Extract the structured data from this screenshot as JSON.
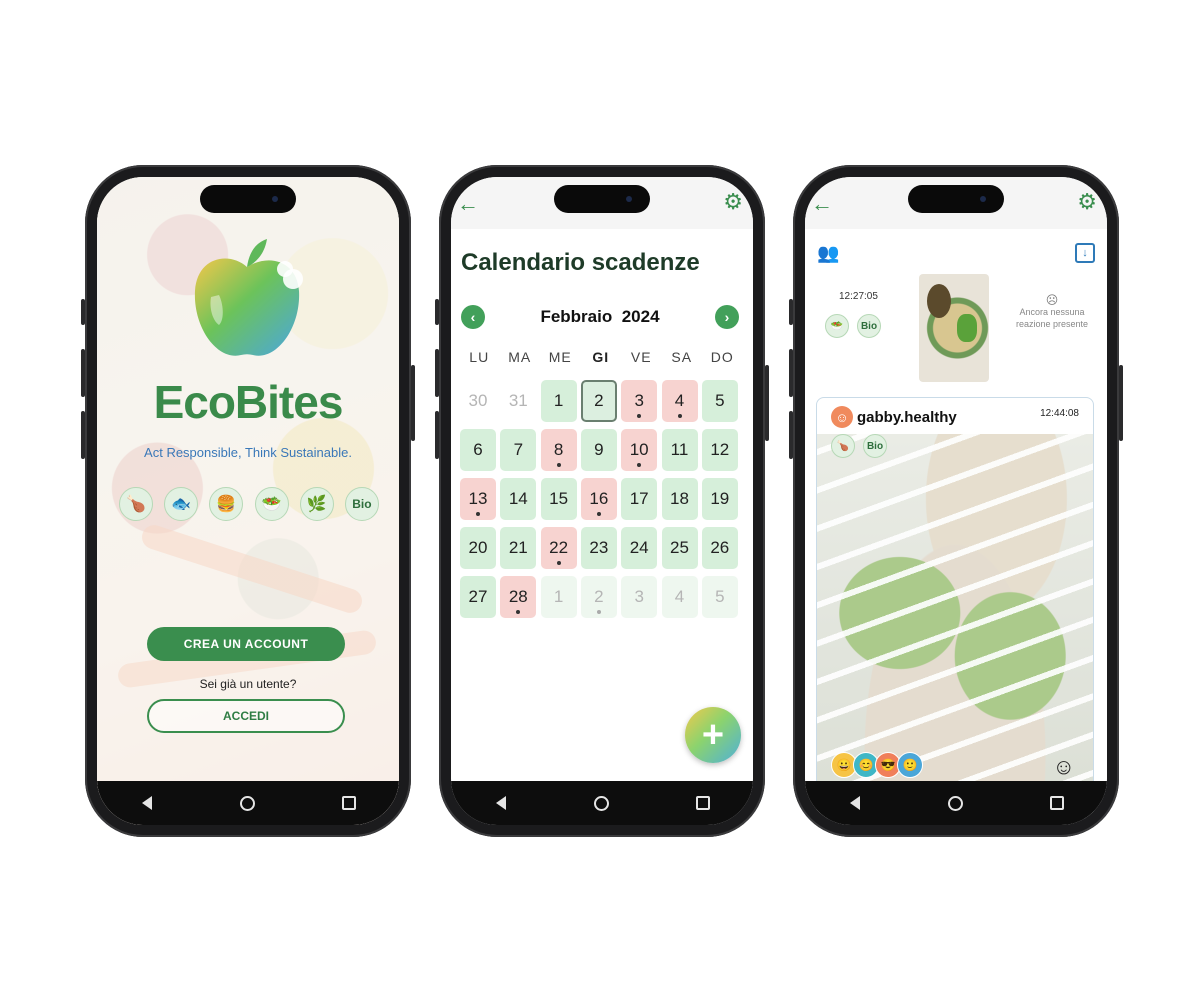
{
  "phone1": {
    "brand": "EcoBites",
    "tagline": "Act Responsible, Think Sustainable.",
    "diet_icons": [
      {
        "name": "meat-icon",
        "glyph": "🍗"
      },
      {
        "name": "fish-icon",
        "glyph": "🐟"
      },
      {
        "name": "burger-icon",
        "glyph": "🍔"
      },
      {
        "name": "salad-bowl-icon",
        "glyph": "🥗"
      },
      {
        "name": "vegan-leaf-icon",
        "glyph": "🌿"
      },
      {
        "name": "bio-icon",
        "glyph": "Bio"
      }
    ],
    "create_account": "CREA UN ACCOUNT",
    "already_user": "Sei già un utente?",
    "login": "ACCEDI"
  },
  "phone2": {
    "title": "Calendario scadenze",
    "month": "Febbraio",
    "year": "2024",
    "weekdays": [
      "LU",
      "MA",
      "ME",
      "GI",
      "VE",
      "SA",
      "DO"
    ],
    "today_weekday": "GI",
    "days": [
      {
        "n": "30",
        "s": "dim"
      },
      {
        "n": "31",
        "s": "dim"
      },
      {
        "n": "1",
        "s": "green"
      },
      {
        "n": "2",
        "s": "sel"
      },
      {
        "n": "3",
        "s": "red",
        "dot": true
      },
      {
        "n": "4",
        "s": "red",
        "dot": true
      },
      {
        "n": "5",
        "s": "green"
      },
      {
        "n": "6",
        "s": "green"
      },
      {
        "n": "7",
        "s": "green"
      },
      {
        "n": "8",
        "s": "red",
        "dot": true
      },
      {
        "n": "9",
        "s": "green"
      },
      {
        "n": "10",
        "s": "red",
        "dot": true
      },
      {
        "n": "11",
        "s": "green"
      },
      {
        "n": "12",
        "s": "green"
      },
      {
        "n": "13",
        "s": "red",
        "dot": true
      },
      {
        "n": "14",
        "s": "green"
      },
      {
        "n": "15",
        "s": "green"
      },
      {
        "n": "16",
        "s": "red",
        "dot": true
      },
      {
        "n": "17",
        "s": "green"
      },
      {
        "n": "18",
        "s": "green"
      },
      {
        "n": "19",
        "s": "green"
      },
      {
        "n": "20",
        "s": "green"
      },
      {
        "n": "21",
        "s": "green"
      },
      {
        "n": "22",
        "s": "red",
        "dot": true
      },
      {
        "n": "23",
        "s": "green"
      },
      {
        "n": "24",
        "s": "green"
      },
      {
        "n": "25",
        "s": "green"
      },
      {
        "n": "26",
        "s": "green"
      },
      {
        "n": "27",
        "s": "green"
      },
      {
        "n": "28",
        "s": "red",
        "dot": true
      },
      {
        "n": "1",
        "s": "dimg"
      },
      {
        "n": "2",
        "s": "dimg",
        "dot": true
      },
      {
        "n": "3",
        "s": "dimg"
      },
      {
        "n": "4",
        "s": "dimg"
      },
      {
        "n": "5",
        "s": "dimg"
      }
    ],
    "fab_icon": "plus-icon"
  },
  "phone3": {
    "post1": {
      "time": "12:27:05",
      "badges": [
        "🥗",
        "Bio"
      ],
      "no_reaction": "Ancora nessuna reazione presente"
    },
    "post2": {
      "username": "gabby.healthy",
      "time": "12:44:08",
      "badges": [
        "🍗",
        "Bio"
      ],
      "reactions": [
        "😀",
        "😊",
        "😎",
        "🙂"
      ]
    }
  },
  "colors": {
    "accent_green": "#3a8e4e",
    "expiring_red": "#f7d3d0",
    "ok_green": "#d6efda",
    "link_blue": "#2e7ab8"
  }
}
